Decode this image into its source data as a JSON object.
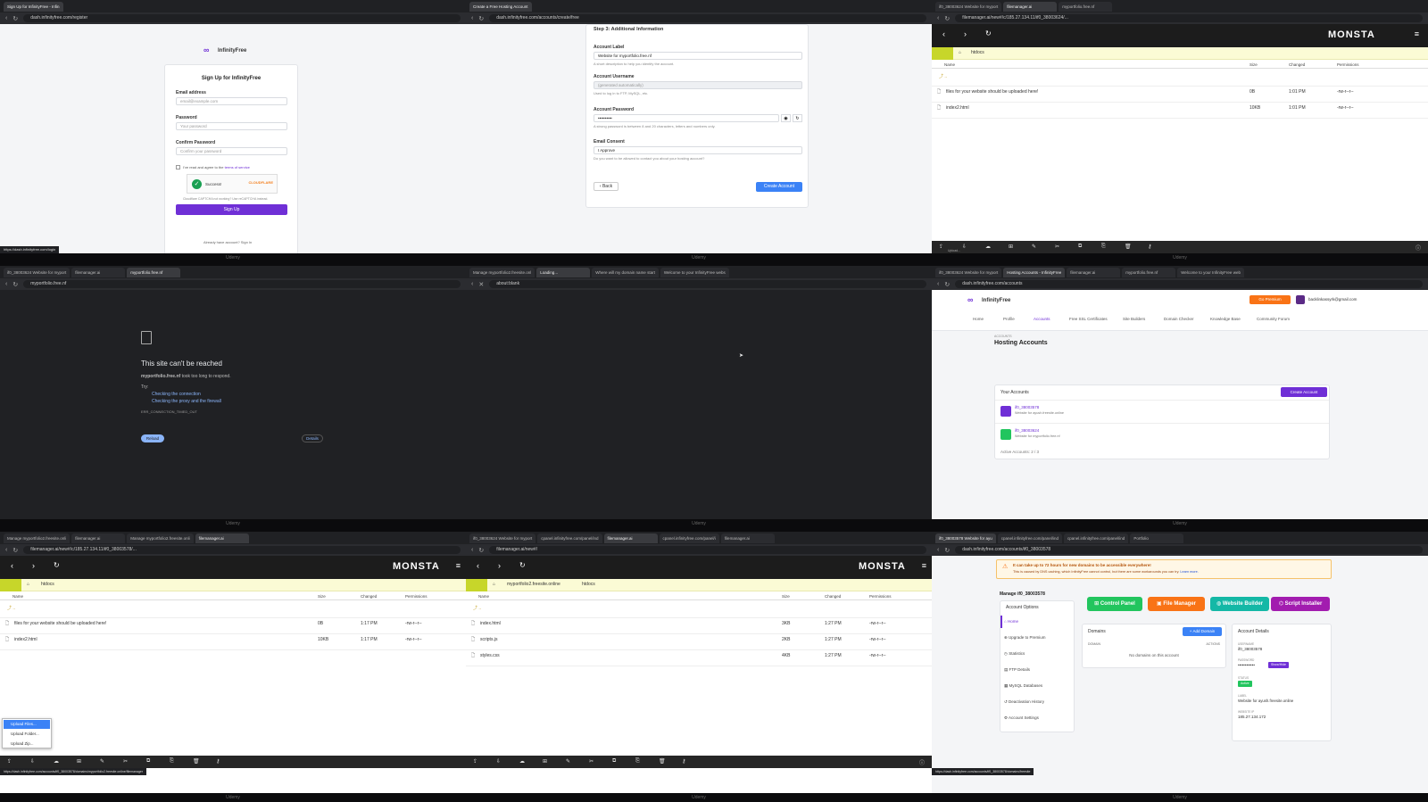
{
  "footer_label": "Udemy",
  "tile1": {
    "tabs": [
      "Sign Up for InfinityFree - Infin"
    ],
    "url": "dash.infinityfree.com/register",
    "brand": "InfinityFree",
    "heading": "Sign Up for InfinityFree",
    "email_label": "Email address",
    "email_placeholder": "email@example.com",
    "password_label": "Password",
    "password_placeholder": "Your password",
    "confirm_label": "Confirm Password",
    "confirm_placeholder": "Confirm your password",
    "terms_prefix": "I've read and agree to the",
    "terms_link": "terms of service",
    "captcha_status": "Success!",
    "captcha_brand": "CLOUDFLARE",
    "captcha_note": "Cloudflare CAPTCHA not working? Use reCAPTCHA instead.",
    "signup_button": "Sign Up",
    "login_prompt": "Already have account? Sign In",
    "status_url": "https://dash.infinityfree.com/login"
  },
  "tile2": {
    "tabs": [
      "Create a Free Hosting Account"
    ],
    "url": "dash.infinityfree.com/accounts/create/free",
    "step": "Step 3: Additional Information",
    "label_title": "Account Label",
    "label_value": "Website for myportfolio.free.nf",
    "label_hint": "A short description to help you identify the account.",
    "user_title": "Account Username",
    "user_value": "(generated automatically)",
    "user_hint": "Used to log in to FTP, MySQL, etc.",
    "pass_title": "Account Password",
    "pass_value": "••••••••••",
    "pass_hint": "A strong password is between 8 and 20 characters, letters and numbers only.",
    "consent_title": "Email Consent",
    "consent_value": "I Approve",
    "consent_hint": "Do you want to be allowed to contact you about your hosting account?",
    "back_button": "Back",
    "create_button": "Create Account"
  },
  "tile3": {
    "tabs": [
      "if0_38003624 Website for myport",
      "filemanager.ai",
      "myportfolio.free.nf"
    ],
    "url": "filemanager.ai/new#/c/185.27.134.11/if0_38003624/...",
    "logo": "MONSTA",
    "path": "htdocs",
    "col_name": "Name",
    "col_size": "Size",
    "col_changed": "Changed",
    "col_perms": "Permissions",
    "files": [
      {
        "name": "files for your website should be uploaded here!",
        "size": "0B",
        "changed": "1:01 PM",
        "perms": "-rw-r--r--"
      },
      {
        "name": "index2.html",
        "size": "10KB",
        "changed": "1:01 PM",
        "perms": "-rw-r--r--"
      }
    ],
    "status": "Upload..."
  },
  "tile4": {
    "tabs": [
      "if0_38003624 Website for myport",
      "filemanager.ai",
      "myportfolio.free.nf"
    ],
    "url": "myportfolio.free.nf",
    "title": "This site can't be reached",
    "host": "myportfolio.free.nf",
    "msg": "took too long to respond.",
    "try": "Try:",
    "tip1": "Checking the connection",
    "tip2": "Checking the proxy and the firewall",
    "code": "ERR_CONNECTION_TIMED_OUT",
    "reload": "Reload",
    "details": "Details"
  },
  "tile5": {
    "tabs": [
      "Manage myportfolio2.freesite.onl",
      "Loading...",
      "Where will my domain name start",
      "Welcome to your InfinityFree webs"
    ],
    "url": "about:blank"
  },
  "tile6": {
    "tabs": [
      "if0_38003624 Website for myport",
      "Hosting Accounts - InfinityFree",
      "filemanager.ai",
      "myportfolio.free.nf",
      "Welcome to your InfinityFree web"
    ],
    "url": "dash.infinityfree.com/accounts",
    "brand": "InfinityFree",
    "premium": "Go Premium",
    "user_email": "backlinkassyrk@gmail.com",
    "nav": [
      "Home",
      "Profile",
      "Accounts",
      "Free SSL Certificates",
      "Site Builders",
      "Domain Checker",
      "Knowledge Base",
      "Community Forum"
    ],
    "crumb": "ACCOUNTS",
    "title": "Hosting Accounts",
    "section": "Your Accounts",
    "create_button": "Create Account",
    "accounts": [
      {
        "id": "if0_38003578",
        "desc": "Website for ayush.freesite.online"
      },
      {
        "id": "if0_38003624",
        "desc": "Website for myportfolio.free.nf"
      }
    ],
    "active": "Active Accounts: 2 / 3"
  },
  "tile7": {
    "tabs": [
      "Manage myportfolio2.freesite.onli",
      "filemanager.ai",
      "Manage myportfolio2.freesite.onli",
      "filemanager.ai"
    ],
    "url": "filemanager.ai/new#/c/185.27.134.11/if0_38003578/...",
    "logo": "MONSTA",
    "path": "htdocs",
    "col_name": "Name",
    "col_size": "Size",
    "col_changed": "Changed",
    "col_perms": "Permissions",
    "files": [
      {
        "name": "files for your website should be uploaded here!",
        "size": "0B",
        "changed": "1:17 PM",
        "perms": "-rw-r--r--"
      },
      {
        "name": "index2.html",
        "size": "10KB",
        "changed": "1:17 PM",
        "perms": "-rw-r--r--"
      }
    ],
    "menu": [
      "Upload Files...",
      "Upload Folder...",
      "Upload Zip..."
    ],
    "status_url": "https://dash.infinityfree.com/accounts/if0_38003578/domains/myportfolio2.freesite.online/filemanager"
  },
  "tile8": {
    "tabs": [
      "if0_38003624 Website for myport",
      "cpanel.infinityfree.com/panel/ind",
      "filemanager.ai",
      "cpanel.infinityfree.com/panel/i",
      "filemanager.ai"
    ],
    "url": "filemanager.ai/new#/",
    "logo": "MONSTA",
    "path_host": "myportfolio2.freesite.online",
    "path": "htdocs",
    "col_name": "Name",
    "col_size": "Size",
    "col_changed": "Changed",
    "col_perms": "Permissions",
    "files": [
      {
        "name": "index.html",
        "size": "3KB",
        "changed": "1:27 PM",
        "perms": "-rw-r--r--"
      },
      {
        "name": "scripts.js",
        "size": "2KB",
        "changed": "1:27 PM",
        "perms": "-rw-r--r--"
      },
      {
        "name": "styles.css",
        "size": "4KB",
        "changed": "1:27 PM",
        "perms": "-rw-r--r--"
      }
    ]
  },
  "tile9": {
    "tabs": [
      "if0_38003578 Website for ayu",
      "cpanel.infinityfree.com/panel/ind",
      "cpanel.infinityfree.com/panel/ind",
      "Portfolio"
    ],
    "url": "dash.infinityfree.com/accounts/if0_38003578",
    "alert_title": "It can take up to 72 hours for new domains to be accessible everywhere!",
    "alert_body": "This is caused by DNS caching, which InfinityFree cannot control, but there are some workarounds you can try.",
    "alert_link": "Learn more.",
    "manage_title": "Manage if0_38003578",
    "options_title": "Account Options",
    "menu": [
      "Home",
      "Upgrade to Premium",
      "Statistics",
      "FTP Details",
      "MySQL Databases",
      "Deactivation History",
      "Account Settings"
    ],
    "btn_cp": "Control Panel",
    "btn_fm": "File Manager",
    "btn_wb": "Website Builder",
    "btn_si": "Script Installer",
    "domains_title": "Domains",
    "add_domain": "Add Domain",
    "col_domain": "DOMAIN",
    "col_actions": "ACTIONS",
    "no_domains": "No domains on this account",
    "details_title": "Account Details",
    "username_lbl": "USERNAME",
    "username": "if0_38003578",
    "password_lbl": "PASSWORD",
    "password": "••••••••••••",
    "showhide": "Show/Hide",
    "status_lbl": "STATUS",
    "status": "Active",
    "label_lbl": "LABEL",
    "label": "Website for ayush.freesite.online",
    "ip_lbl": "WEBSITE IP",
    "ip": "185.27.134.172",
    "status_url": "https://dash.infinityfree.com/accounts/if0_38003578/domains/freesite"
  }
}
